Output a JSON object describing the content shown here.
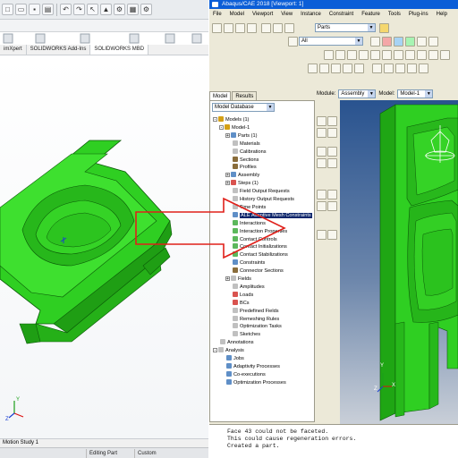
{
  "colors": {
    "model_green": "#2fcf22",
    "model_edge": "#0b5a08",
    "arrow_red": "#e0201a",
    "abaqus_titlebar": "#0b5ed7",
    "tree_selected": "#0a246a"
  },
  "solidworks": {
    "tabs": [
      "imXpert",
      "SOLIDWORKS Add-Ins",
      "SOLIDWORKS MBD"
    ],
    "bottom_tab": "Motion Study 1",
    "status": {
      "editing": "Editing Part",
      "units": "Custom"
    },
    "triad_labels": [
      "Y",
      "Z"
    ]
  },
  "abaqus": {
    "title": "Abaqus/CAE 2018 [Viewport: 1]",
    "menu": [
      "File",
      "Model",
      "Viewport",
      "View",
      "Instance",
      "Constraint",
      "Feature",
      "Tools",
      "Plug-ins",
      "Help"
    ],
    "toolbar": {
      "parts_combo": "Parts",
      "all_combo": "All"
    },
    "tree_tabs": [
      "Model",
      "Results"
    ],
    "tree_combo": "Model Database",
    "tree_items": [
      {
        "label": "Models (1)",
        "indent": 0,
        "expander": "-",
        "icon": "#d4a017"
      },
      {
        "label": "Model-1",
        "indent": 1,
        "expander": "-",
        "icon": "#d4a017"
      },
      {
        "label": "Parts (1)",
        "indent": 2,
        "expander": "+",
        "icon": "#5f8fc7"
      },
      {
        "label": "Materials",
        "indent": 2,
        "expander": "",
        "icon": "#c0c0c0"
      },
      {
        "label": "Calibrations",
        "indent": 2,
        "expander": "",
        "icon": "#c0c0c0"
      },
      {
        "label": "Sections",
        "indent": 2,
        "expander": "",
        "icon": "#8a6d3b"
      },
      {
        "label": "Profiles",
        "indent": 2,
        "expander": "",
        "icon": "#8a6d3b"
      },
      {
        "label": "Assembly",
        "indent": 2,
        "expander": "+",
        "icon": "#5f8fc7"
      },
      {
        "label": "Steps (1)",
        "indent": 2,
        "expander": "+",
        "icon": "#d9534f"
      },
      {
        "label": "Field Output Requests",
        "indent": 2,
        "expander": "",
        "icon": "#c0c0c0"
      },
      {
        "label": "History Output Requests",
        "indent": 2,
        "expander": "",
        "icon": "#c0c0c0"
      },
      {
        "label": "Time Points",
        "indent": 2,
        "expander": "",
        "icon": "#c0c0c0"
      },
      {
        "label": "ALE Adaptive Mesh Constraints",
        "indent": 2,
        "expander": "",
        "icon": "#5f8fc7",
        "selected": true
      },
      {
        "label": "Interactions",
        "indent": 2,
        "expander": "",
        "icon": "#5cb85c"
      },
      {
        "label": "Interaction Properties",
        "indent": 2,
        "expander": "",
        "icon": "#5cb85c"
      },
      {
        "label": "Contact Controls",
        "indent": 2,
        "expander": "",
        "icon": "#5cb85c"
      },
      {
        "label": "Contact Initializations",
        "indent": 2,
        "expander": "",
        "icon": "#5cb85c"
      },
      {
        "label": "Contact Stabilizations",
        "indent": 2,
        "expander": "",
        "icon": "#5cb85c"
      },
      {
        "label": "Constraints",
        "indent": 2,
        "expander": "",
        "icon": "#5f8fc7"
      },
      {
        "label": "Connector Sections",
        "indent": 2,
        "expander": "",
        "icon": "#8a6d3b"
      },
      {
        "label": "Fields",
        "indent": 2,
        "expander": "+",
        "icon": "#c0c0c0"
      },
      {
        "label": "Amplitudes",
        "indent": 2,
        "expander": "",
        "icon": "#c0c0c0"
      },
      {
        "label": "Loads",
        "indent": 2,
        "expander": "",
        "icon": "#d9534f"
      },
      {
        "label": "BCs",
        "indent": 2,
        "expander": "",
        "icon": "#d9534f"
      },
      {
        "label": "Predefined Fields",
        "indent": 2,
        "expander": "",
        "icon": "#c0c0c0"
      },
      {
        "label": "Remeshing Rules",
        "indent": 2,
        "expander": "",
        "icon": "#c0c0c0"
      },
      {
        "label": "Optimization Tasks",
        "indent": 2,
        "expander": "",
        "icon": "#c0c0c0"
      },
      {
        "label": "Sketches",
        "indent": 2,
        "expander": "",
        "icon": "#c0c0c0"
      },
      {
        "label": "Annotations",
        "indent": 0,
        "expander": "",
        "icon": "#c0c0c0"
      },
      {
        "label": "Analysis",
        "indent": 0,
        "expander": "-",
        "icon": "#c0c0c0"
      },
      {
        "label": "Jobs",
        "indent": 1,
        "expander": "",
        "icon": "#5f8fc7"
      },
      {
        "label": "Adaptivity Processes",
        "indent": 1,
        "expander": "",
        "icon": "#5f8fc7"
      },
      {
        "label": "Co-executions",
        "indent": 1,
        "expander": "",
        "icon": "#5f8fc7"
      },
      {
        "label": "Optimization Processes",
        "indent": 1,
        "expander": "",
        "icon": "#5f8fc7"
      }
    ],
    "viewport_head": {
      "module_label": "Module:",
      "module_value": "Assembly",
      "model_label": "Model:",
      "model_value": "Model-1"
    },
    "triad_labels": [
      "Y",
      "Z",
      "X"
    ],
    "messages": [
      "Face 43 could not be faceted.",
      "This could cause regeneration errors.",
      "Created a part."
    ]
  }
}
